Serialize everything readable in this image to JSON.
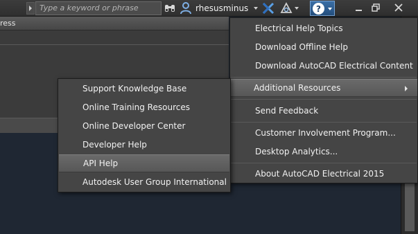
{
  "titlebar": {
    "search_placeholder": "Type a keyword or phrase",
    "username": "rhesusminus"
  },
  "panel": {
    "header_text": "ress"
  },
  "help_menu": {
    "items": [
      "Electrical Help Topics",
      "Download Offline Help",
      "Download AutoCAD Electrical Content",
      "Additional Resources",
      "Send Feedback",
      "Customer Involvement Program...",
      "Desktop Analytics...",
      "About AutoCAD Electrical 2015"
    ]
  },
  "additional_resources_menu": {
    "items": [
      "Support Knowledge Base",
      "Online Training Resources",
      "Online Developer Center",
      "Developer Help",
      "API Help",
      "Autodesk User Group International"
    ]
  },
  "colors": {
    "accent": "#3a6ea5",
    "menu_bg": "#454545",
    "highlight": "#6a6a6a"
  }
}
